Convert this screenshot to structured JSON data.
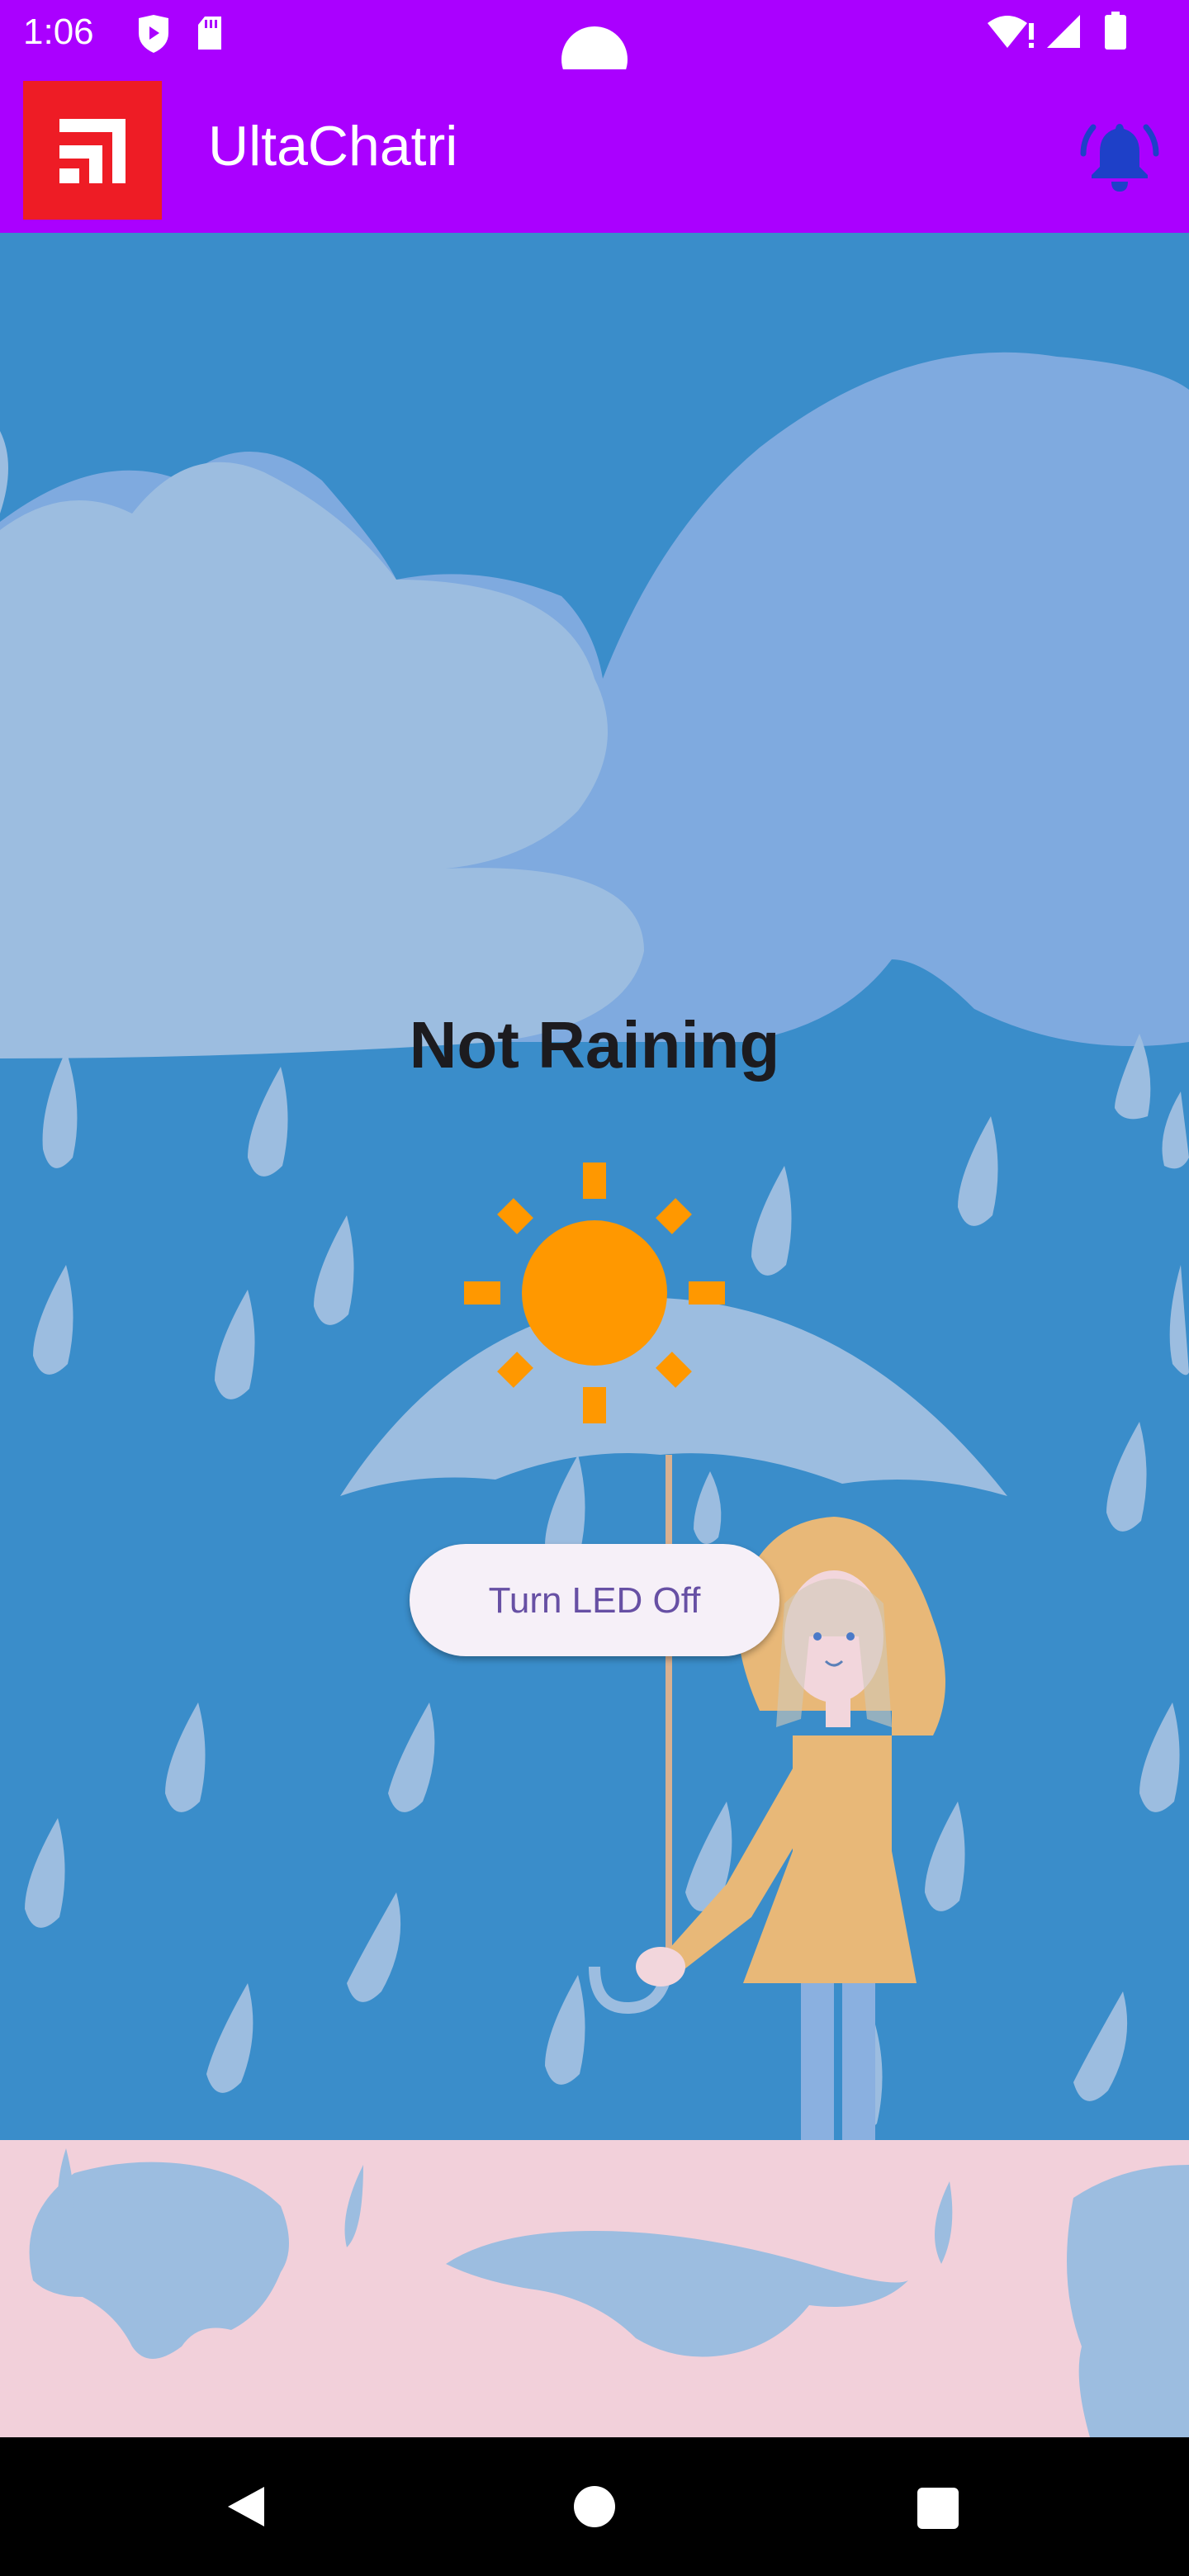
{
  "status_bar": {
    "time": "1:06",
    "icons": [
      "shield-play-icon",
      "sd-card-icon",
      "wifi-alert-icon",
      "cell-signal-icon",
      "battery-icon"
    ]
  },
  "app_bar": {
    "title": "UltaChatri",
    "logo_icon": "app-logo-icon",
    "action_icon": "bell-ringing-icon",
    "background": "#aa00ff"
  },
  "main": {
    "status_text": "Not Raining",
    "weather_icon": "sun-icon",
    "sun_color": "#ff9800",
    "led_button_label": "Turn LED Off",
    "background": "#3a8dca"
  },
  "nav_bar": {
    "icons": [
      "back-icon",
      "home-icon",
      "recents-icon"
    ]
  }
}
